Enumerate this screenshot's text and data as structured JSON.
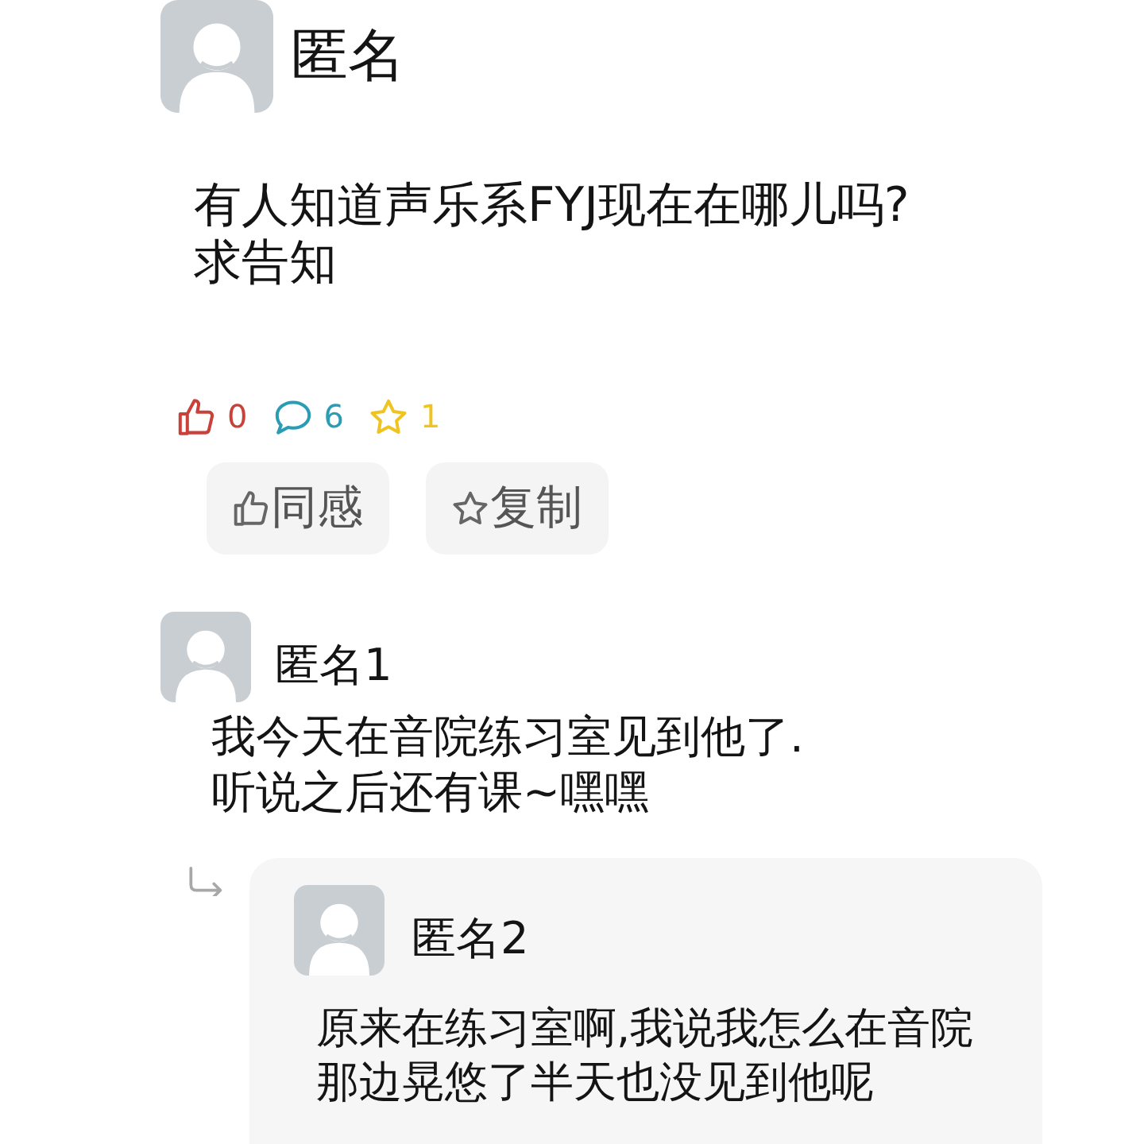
{
  "post": {
    "author": "匿名",
    "text": "有人知道声乐系FYJ现在在哪儿吗?\n求告知",
    "stats": [
      {
        "kind": "like",
        "count": "0",
        "color": "#c8423a"
      },
      {
        "kind": "comment",
        "count": "6",
        "color": "#2a9cb4"
      },
      {
        "kind": "star",
        "count": "1",
        "color": "#f0c420"
      }
    ],
    "actions": [
      {
        "kind": "like",
        "label": "同感"
      },
      {
        "kind": "star",
        "label": "复制"
      }
    ]
  },
  "comments": [
    {
      "author": "匿名1",
      "text": "我今天在音院练习室见到他了.\n听说之后还有课~嘿嘿",
      "replies": [
        {
          "author": "匿名2",
          "text": "原来在练习室啊,我说我怎么在音院那边晃悠了半天也没见到他呢"
        }
      ]
    }
  ]
}
